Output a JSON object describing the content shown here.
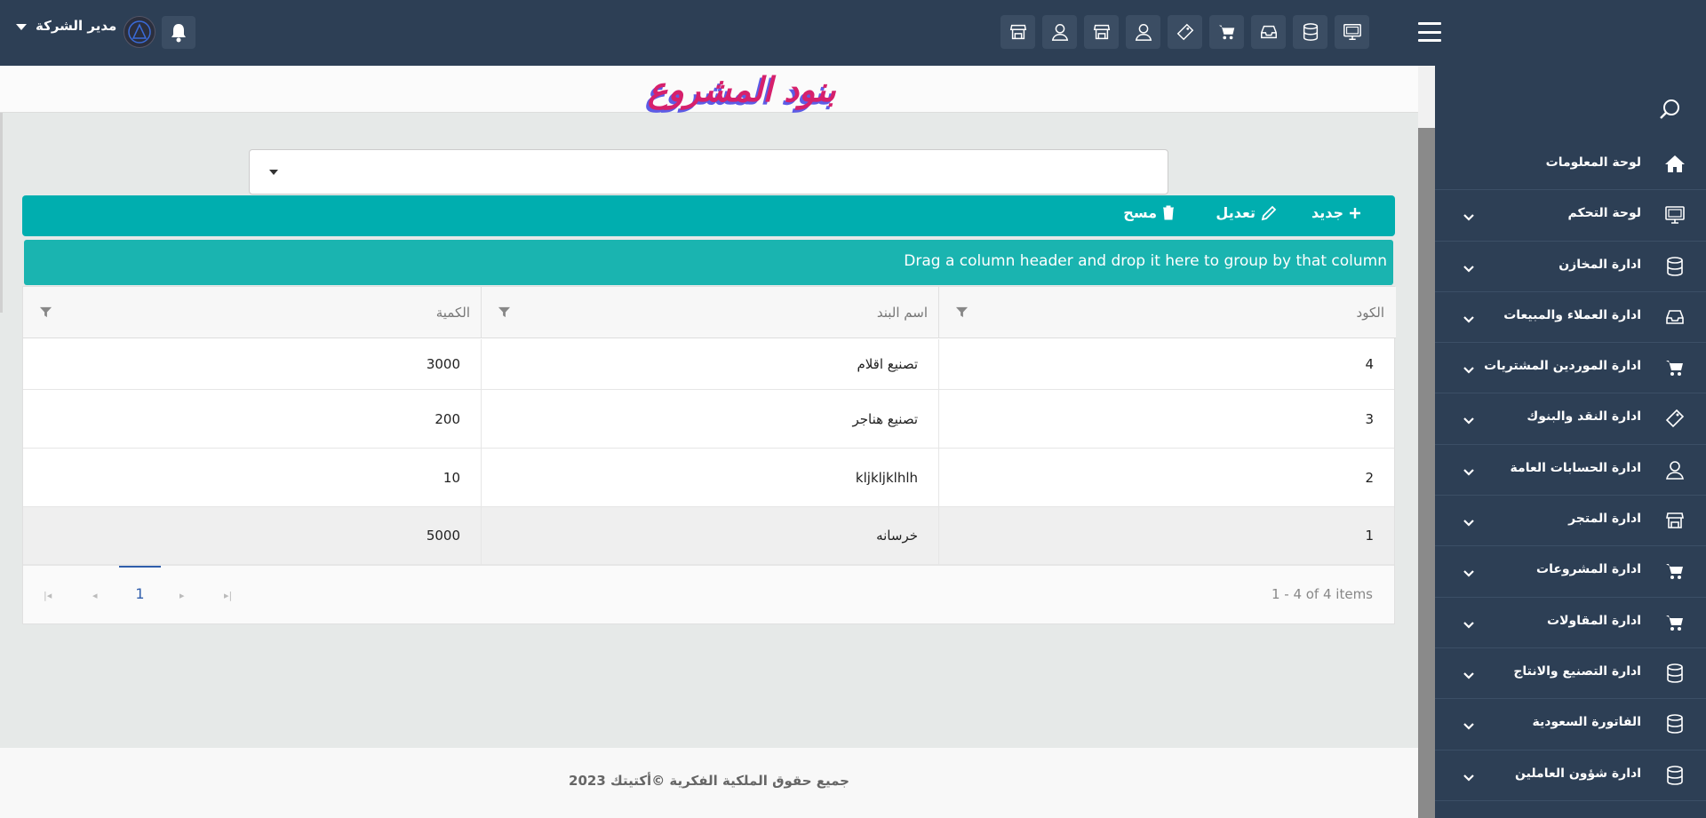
{
  "header": {
    "user_name": "مدير الشركة",
    "quick_icons": [
      "store-icon",
      "user-icon",
      "store-icon",
      "user-icon",
      "ticket-icon",
      "cart-icon",
      "inbox-icon",
      "database-icon",
      "monitor-icon"
    ]
  },
  "sidebar": {
    "items": [
      {
        "label": "لوحة المعلومات",
        "icon": "home-icon",
        "expandable": false
      },
      {
        "label": "لوحة التحكم",
        "icon": "monitor-icon",
        "expandable": true
      },
      {
        "label": "ادارة المخازن",
        "icon": "database-icon",
        "expandable": true
      },
      {
        "label": "ادارة العملاء والمبيعات",
        "icon": "inbox-icon",
        "expandable": true
      },
      {
        "label": "ادارة الموردين المشتريات",
        "icon": "cart-icon",
        "expandable": true
      },
      {
        "label": "ادارة النقد والبنوك",
        "icon": "ticket-icon",
        "expandable": true
      },
      {
        "label": "ادارة الحسابات العامة",
        "icon": "user-icon",
        "expandable": true
      },
      {
        "label": "ادارة المتجر",
        "icon": "store-icon",
        "expandable": true
      },
      {
        "label": "ادارة المشروعات",
        "icon": "cart-icon",
        "expandable": true
      },
      {
        "label": "ادارة المقاولات",
        "icon": "cart-icon",
        "expandable": true
      },
      {
        "label": "ادارة التصنيع والانتاج",
        "icon": "database-icon",
        "expandable": true
      },
      {
        "label": "الفاتورة السعودية",
        "icon": "database-icon",
        "expandable": true
      },
      {
        "label": "ادارة شؤون العاملين",
        "icon": "database-icon",
        "expandable": true
      }
    ]
  },
  "page": {
    "title": "بنود المشروع"
  },
  "combo": {
    "value": ""
  },
  "toolbar": {
    "new_label": "جديد",
    "edit_label": "تعديل",
    "delete_label": "مسح"
  },
  "grid": {
    "group_panel_text": "Drag a column header and drop it here to group by that column",
    "columns": [
      "الكود",
      "اسم البند",
      "الكمية"
    ],
    "rows": [
      {
        "code": "4",
        "name": "تصنيع اقلام",
        "qty": "3000"
      },
      {
        "code": "3",
        "name": "تصنيع هناجر",
        "qty": "200"
      },
      {
        "code": "2",
        "name": "kljkljklhlh",
        "qty": "10"
      },
      {
        "code": "1",
        "name": "خرسانه",
        "qty": "5000"
      }
    ],
    "pager": {
      "current_page": "1",
      "info": "1 - 4 of 4 items"
    }
  },
  "footer": {
    "text": "جميع حقوق الملكية الفكرية ©أكتيتك 2023"
  },
  "colors": {
    "header_bg": "#2d3f55",
    "toolbar_bg": "#00aeaf",
    "title_fg": "#d6206c",
    "title_shadow": "#5c5ce6"
  }
}
